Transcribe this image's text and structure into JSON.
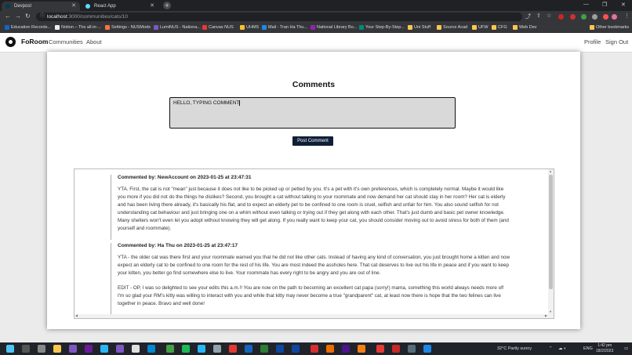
{
  "browser": {
    "tabs": [
      {
        "title": "Devpost",
        "active": false
      },
      {
        "title": "React App",
        "active": true
      }
    ],
    "url_host": "localhost",
    "url_path": ":3000/communities/cats/10",
    "bookmarks": [
      "Education Records...",
      "Notion – The all-in-...",
      "Settings - NUSMods",
      "LumiNUS - Nationa...",
      "Canvas NUS",
      "UHMS",
      "Mail - Tran Ha Thu...",
      "National Library Bo...",
      "Your Step-By-Step...",
      "Uni Stuff",
      "Source Acad",
      "UFW",
      "CFG",
      "Web Dev"
    ],
    "other_bookmarks": "Other bookmarks"
  },
  "nav": {
    "brand": "FoRoom",
    "links": [
      "Communities",
      "About"
    ],
    "right_links": [
      "Profile",
      "Sign Out"
    ]
  },
  "comments_section": {
    "title": "Comments",
    "input_value": "HELLO, TYPING COMMENT",
    "post_button": "Post Comment"
  },
  "comments": [
    {
      "meta": "Commented by: NewAccount on 2023-01-25 at 23:47:31",
      "paragraphs": [
        "YTA. First, the cat is not \"mean\" just because it does not like to be picked up or petted by you. It's a pet with it's own preferences, which is completely normal. Maybe it would like you more if you did not do the things he dislikes? Second, you brought a cat without talking to your roommate and now demand her cat should stay in her room? Her cat is elderly and has been living there already, it's basically his flat, and to expect an elderly pet to be confined to one room is cruel, selfish and unfair for him. You also sound selfish for not understanding cat behaviour and just bringing one on a whim without even talking or trying out if they get along with each other. That's just dumb and basic pet owner knowledge. Many shelters won't even let you adopt without knowing they will get along. If you really want to keep your cat, you should consider moving out to avoid stress for both of them (and yourself and roommate)."
      ]
    },
    {
      "meta": "Commented by: Ha Thu on 2023-01-25 at 23:47:17",
      "paragraphs": [
        "YTA - the older cat was there first and your roommate warned you that he did not like other cats. Instead of having any kind of conversation, you just brought home a kitten and now expect an elderly cat to be confined to one room for the rest of his life. You are most indeed the assholes here. That cat deserves to live out his life in peace and if you want to keep your kitten, you better go find somewhere else to live. Your roommate has every right to be angry and you are out of line.",
        "EDIT - OP, I was so delighted to see your edits this a.m.!! You are now on the path to becoming an excellent cat papa (sorry!) mama, something this world always needs more of! I'm so glad your RM's kitty was willing to interact with you and while that kitty may never become a true \"grandparent\" cat, at least now there is hope that the two felines can live together in peace. Bravo and well done!"
      ]
    }
  ],
  "taskbar": {
    "weather": "32°C  Partly sunny",
    "lang": "ENG",
    "time": "1:42 pm",
    "date": "18/2/2023"
  },
  "colors": {
    "primary_button": "#0f1f38",
    "input_bg": "#d9d9d9"
  }
}
